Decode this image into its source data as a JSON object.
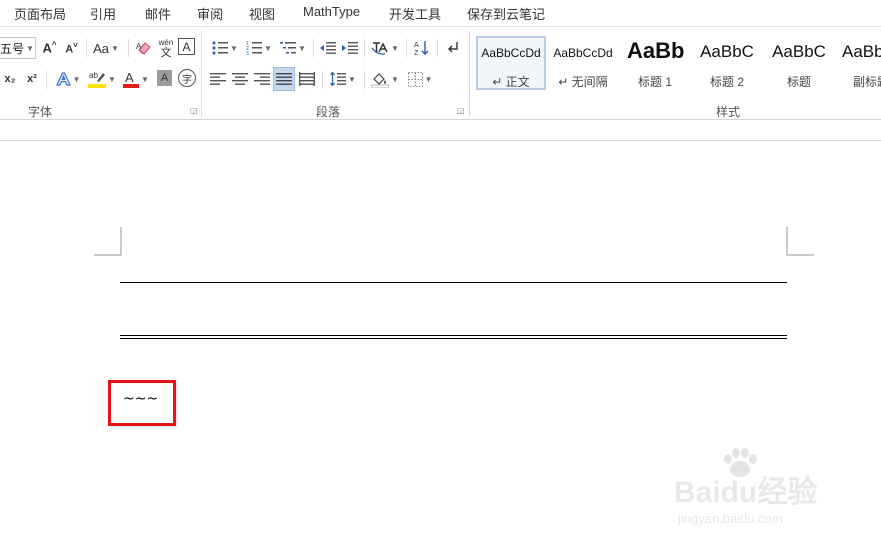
{
  "tabs": [
    "页面布局",
    "引用",
    "邮件",
    "审阅",
    "视图",
    "MathType",
    "开发工具",
    "保存到云笔记"
  ],
  "font_group": {
    "size_value": "五号",
    "change_case_label": "Aa",
    "phonetic_top": "wén",
    "phonetic_bottom": "文",
    "char_border_label": "A",
    "subscript_label": "x₂",
    "superscript_label": "x²",
    "shading_label": "A",
    "enclose_label": "字",
    "label": "字体"
  },
  "paragraph_group": {
    "label": "段落"
  },
  "styles_group": {
    "label": "样式",
    "items": [
      {
        "sample": "AaBbCcDd",
        "name": "↵ 正文"
      },
      {
        "sample": "AaBbCcDd",
        "name": "↵ 无间隔"
      },
      {
        "sample": "AaBb",
        "name": "标题 1"
      },
      {
        "sample": "AaBbC",
        "name": "标题 2"
      },
      {
        "sample": "AaBbC",
        "name": "标题"
      },
      {
        "sample": "AaBb",
        "name": "副标题"
      }
    ]
  },
  "document": {
    "text": "~~~"
  },
  "watermark": {
    "brand": "Baidu经验",
    "url": "jingyan.baidu.com"
  },
  "colors": {
    "highlight_box": "#e5141b",
    "text_highlight": "#ffe400",
    "font_color": "#e21b1b",
    "active_style_border": "#b9cde8"
  }
}
